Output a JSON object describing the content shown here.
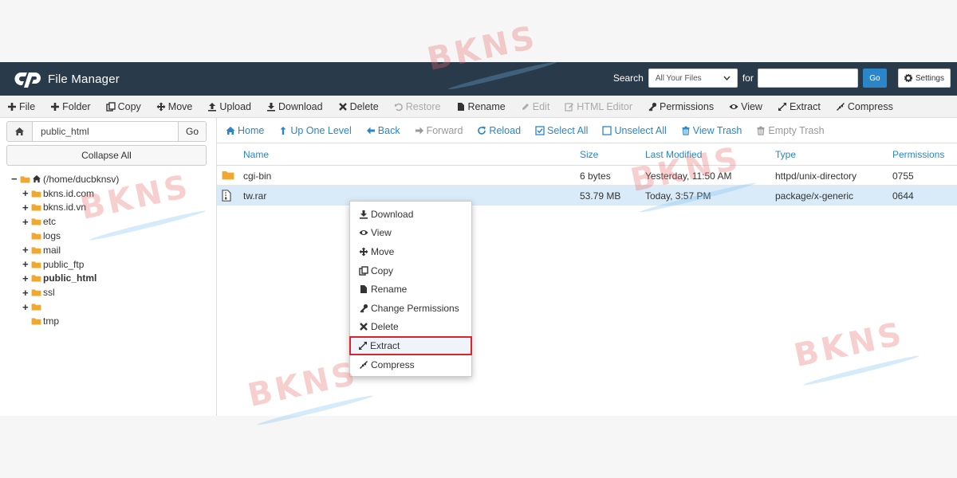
{
  "header": {
    "title": "File Manager",
    "search_label": "Search",
    "search_scope": "All Your Files",
    "for_label": "for",
    "search_value": "",
    "go_label": "Go",
    "settings_label": "Settings"
  },
  "toolbar": [
    {
      "name": "file",
      "label": "File",
      "icon": "plus-icon",
      "enabled": true
    },
    {
      "name": "folder",
      "label": "Folder",
      "icon": "plus-icon",
      "enabled": true
    },
    {
      "name": "copy",
      "label": "Copy",
      "icon": "copy-icon",
      "enabled": true
    },
    {
      "name": "move",
      "label": "Move",
      "icon": "move-icon",
      "enabled": true
    },
    {
      "name": "upload",
      "label": "Upload",
      "icon": "upload-icon",
      "enabled": true
    },
    {
      "name": "download",
      "label": "Download",
      "icon": "download-icon",
      "enabled": true
    },
    {
      "name": "delete",
      "label": "Delete",
      "icon": "x-icon",
      "enabled": true
    },
    {
      "name": "restore",
      "label": "Restore",
      "icon": "undo-icon",
      "enabled": false
    },
    {
      "name": "rename",
      "label": "Rename",
      "icon": "file-icon",
      "enabled": true
    },
    {
      "name": "edit",
      "label": "Edit",
      "icon": "pencil-icon",
      "enabled": false
    },
    {
      "name": "html-editor",
      "label": "HTML Editor",
      "icon": "edit-box-icon",
      "enabled": false
    },
    {
      "name": "permissions",
      "label": "Permissions",
      "icon": "key-icon",
      "enabled": true
    },
    {
      "name": "view",
      "label": "View",
      "icon": "eye-icon",
      "enabled": true
    },
    {
      "name": "extract",
      "label": "Extract",
      "icon": "expand-icon",
      "enabled": true
    },
    {
      "name": "compress",
      "label": "Compress",
      "icon": "compress-icon",
      "enabled": true
    }
  ],
  "left": {
    "path_value": "public_html",
    "go_label": "Go",
    "collapse_label": "Collapse All",
    "tree": [
      {
        "label": "(/home/ducbknsv)",
        "toggle": "−",
        "home": true,
        "bold": false,
        "indent": 0
      },
      {
        "label": "bkns.id.com",
        "toggle": "+",
        "bold": false,
        "indent": 1
      },
      {
        "label": "bkns.id.vn",
        "toggle": "+",
        "bold": false,
        "indent": 1
      },
      {
        "label": "etc",
        "toggle": "+",
        "bold": false,
        "indent": 1
      },
      {
        "label": "logs",
        "toggle": "",
        "bold": false,
        "indent": 1
      },
      {
        "label": "mail",
        "toggle": "+",
        "bold": false,
        "indent": 1
      },
      {
        "label": "public_ftp",
        "toggle": "+",
        "bold": false,
        "indent": 1
      },
      {
        "label": "public_html",
        "toggle": "+",
        "bold": true,
        "indent": 1
      },
      {
        "label": "ssl",
        "toggle": "+",
        "bold": false,
        "indent": 1
      },
      {
        "label": "",
        "toggle": "+",
        "bold": false,
        "indent": 1
      },
      {
        "label": "tmp",
        "toggle": "",
        "bold": false,
        "indent": 1
      }
    ]
  },
  "nav": [
    {
      "name": "home",
      "label": "Home",
      "icon": "home-icon",
      "enabled": true
    },
    {
      "name": "up-one-level",
      "label": "Up One Level",
      "icon": "level-up-icon",
      "enabled": true
    },
    {
      "name": "back",
      "label": "Back",
      "icon": "arrow-left-icon",
      "enabled": true
    },
    {
      "name": "forward",
      "label": "Forward",
      "icon": "arrow-right-icon",
      "enabled": false
    },
    {
      "name": "reload",
      "label": "Reload",
      "icon": "reload-icon",
      "enabled": true
    },
    {
      "name": "select-all",
      "label": "Select All",
      "icon": "checkbox-checked-icon",
      "enabled": true
    },
    {
      "name": "unselect-all",
      "label": "Unselect All",
      "icon": "checkbox-empty-icon",
      "enabled": true
    },
    {
      "name": "view-trash",
      "label": "View Trash",
      "icon": "trash-icon",
      "enabled": true
    },
    {
      "name": "empty-trash",
      "label": "Empty Trash",
      "icon": "trash-icon",
      "enabled": false
    }
  ],
  "table": {
    "columns": [
      "Name",
      "Size",
      "Last Modified",
      "Type",
      "Permissions"
    ],
    "rows": [
      {
        "name": "cgi-bin",
        "size": "6 bytes",
        "modified": "Yesterday, 11:50 AM",
        "type": "httpd/unix-directory",
        "perms": "0755",
        "icon": "folder-icon",
        "selected": false
      },
      {
        "name": "tw.rar",
        "size": "53.79 MB",
        "modified": "Today, 3:57 PM",
        "type": "package/x-generic",
        "perms": "0644",
        "icon": "archive-file-icon",
        "selected": true
      }
    ]
  },
  "context_menu": [
    {
      "name": "download",
      "label": "Download",
      "icon": "download-icon"
    },
    {
      "name": "view",
      "label": "View",
      "icon": "eye-icon"
    },
    {
      "name": "move",
      "label": "Move",
      "icon": "move-icon"
    },
    {
      "name": "copy",
      "label": "Copy",
      "icon": "copy-icon"
    },
    {
      "name": "rename",
      "label": "Rename",
      "icon": "file-icon"
    },
    {
      "name": "change-permissions",
      "label": "Change Permissions",
      "icon": "key-icon"
    },
    {
      "name": "delete",
      "label": "Delete",
      "icon": "x-icon"
    },
    {
      "name": "extract",
      "label": "Extract",
      "icon": "expand-icon",
      "highlight": true
    },
    {
      "name": "compress",
      "label": "Compress",
      "icon": "compress-icon"
    }
  ],
  "watermark_text": "BKNS",
  "colors": {
    "header_bg": "#293a4a",
    "link_blue": "#2a86c8",
    "selected_row": "#d9ebf8",
    "folder_orange": "#f0a830",
    "highlight_red": "#d9262c",
    "watermark_red": "#e86a6a"
  }
}
